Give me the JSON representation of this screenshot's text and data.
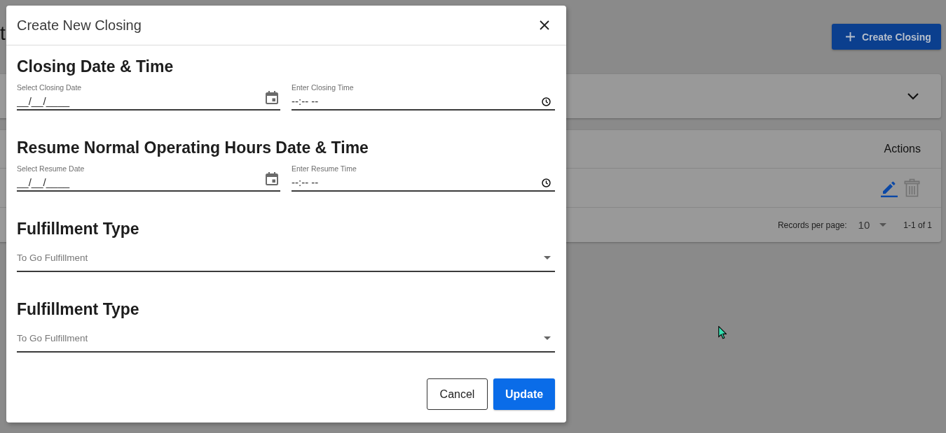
{
  "page": {
    "title_fragment": "t",
    "create_button": {
      "label": "Create Closing"
    },
    "filter_panel": {
      "expanded": false
    },
    "table": {
      "columns": [
        "Actions"
      ],
      "rows": [
        {
          "actions": [
            {
              "kind": "edit"
            },
            {
              "kind": "delete"
            }
          ]
        }
      ],
      "pagination": {
        "records_per_page_label": "Records per page:",
        "records_per_page": "10",
        "range": "1-1 of 1"
      }
    }
  },
  "dialog": {
    "title": "Create New Closing",
    "sections": [
      {
        "kind": "datetime",
        "heading": "Closing Date & Time",
        "date": {
          "label": "Select Closing Date",
          "placeholder": "__/__/____"
        },
        "time": {
          "label": "Enter Closing Time",
          "placeholder": "--:-- --"
        }
      },
      {
        "kind": "datetime",
        "heading": "Resume Normal Operating Hours Date & Time",
        "date": {
          "label": "Select Resume Date",
          "placeholder": "__/__/____"
        },
        "time": {
          "label": "Enter Resume Time",
          "placeholder": "--:-- --"
        }
      },
      {
        "kind": "select",
        "heading": "Fulfillment Type",
        "value": "To Go Fulfillment"
      },
      {
        "kind": "select",
        "heading": "Fulfillment Type",
        "value": "To Go Fulfillment"
      }
    ],
    "buttons": [
      {
        "kind": "secondary",
        "label": "Cancel"
      },
      {
        "kind": "primary",
        "label": "Update"
      }
    ]
  }
}
